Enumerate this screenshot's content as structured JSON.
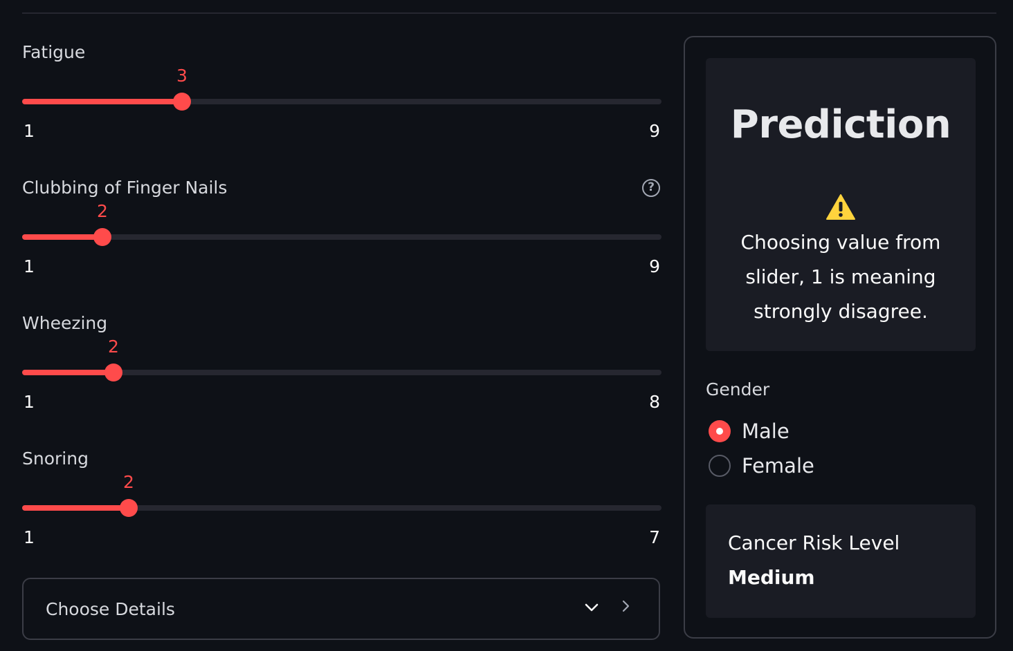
{
  "sliders": [
    {
      "label": "Fatigue",
      "value": 3,
      "min": 1,
      "max": 9,
      "has_help": false,
      "value_text": "3",
      "min_text": "1",
      "max_text": "9"
    },
    {
      "label": "Clubbing of Finger Nails",
      "value": 2,
      "min": 1,
      "max": 9,
      "has_help": true,
      "value_text": "2",
      "min_text": "1",
      "max_text": "9"
    },
    {
      "label": "Wheezing",
      "value": 2,
      "min": 1,
      "max": 8,
      "has_help": false,
      "value_text": "2",
      "min_text": "1",
      "max_text": "8"
    },
    {
      "label": "Snoring",
      "value": 2,
      "min": 1,
      "max": 7,
      "has_help": false,
      "value_text": "2",
      "min_text": "1",
      "max_text": "7"
    }
  ],
  "help_icon_glyph": "?",
  "expander": {
    "label": "Choose Details",
    "icons": [
      "chevron-down-icon",
      "chevron-right-icon"
    ]
  },
  "prediction": {
    "title": "Prediction",
    "icon": "warning-icon",
    "note": "Choosing value from slider, 1 is meaning strongly disagree."
  },
  "gender": {
    "label": "Gender",
    "options": [
      {
        "label": "Male",
        "selected": true
      },
      {
        "label": "Female",
        "selected": false
      }
    ]
  },
  "risk": {
    "label": "Cancer Risk Level",
    "value": "Medium"
  },
  "colors": {
    "background": "#0e1117",
    "accent": "#ff4b4b",
    "track": "#262730",
    "card": "#1a1c24",
    "warning": "#ffd33d"
  }
}
